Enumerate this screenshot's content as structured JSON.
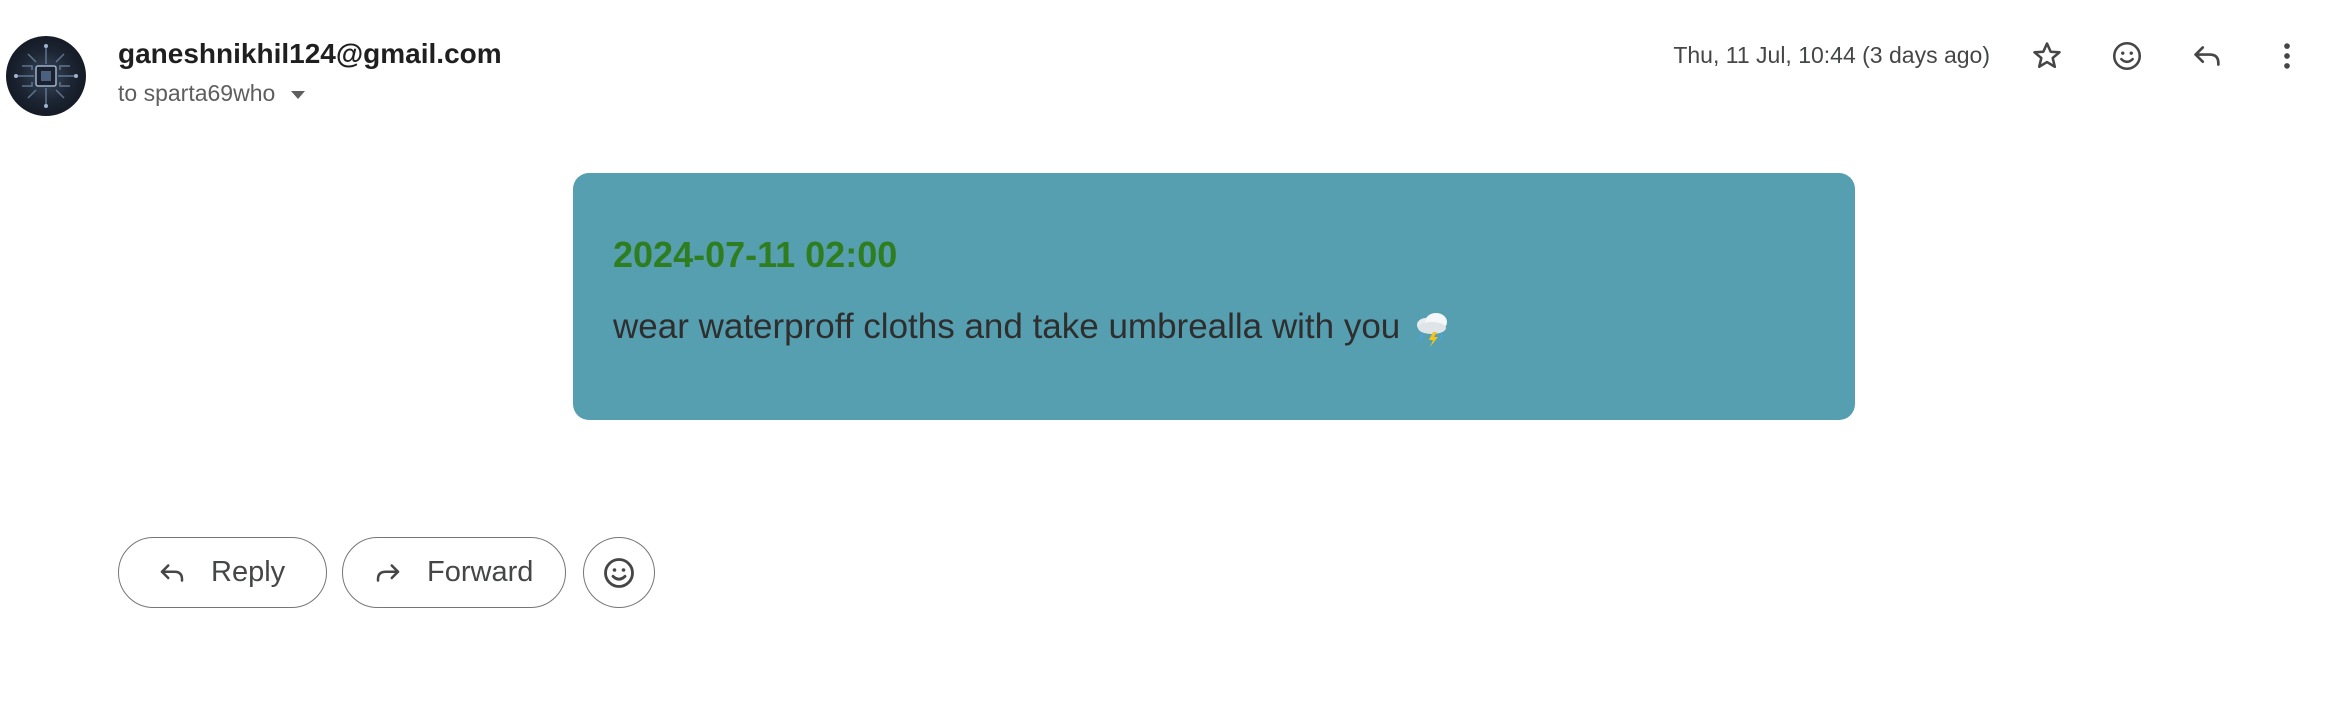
{
  "sender": {
    "email": "ganeshnikhil124@gmail.com",
    "recipient_line": "to sparta69who"
  },
  "meta": {
    "date": "Thu, 11 Jul, 10:44 (3 days ago)"
  },
  "header_icons": [
    "star-icon",
    "emoji-icon",
    "reply-icon",
    "more-vertical-icon"
  ],
  "message": {
    "date_heading": "2024-07-11 02:00",
    "body": "wear waterproff cloths and take umbrealla with you",
    "emoji": "storm-cloud-icon",
    "card_color": "#569fb0",
    "heading_color": "#2e7d1e"
  },
  "actions": {
    "reply_label": "Reply",
    "forward_label": "Forward",
    "react": "emoji-icon"
  }
}
